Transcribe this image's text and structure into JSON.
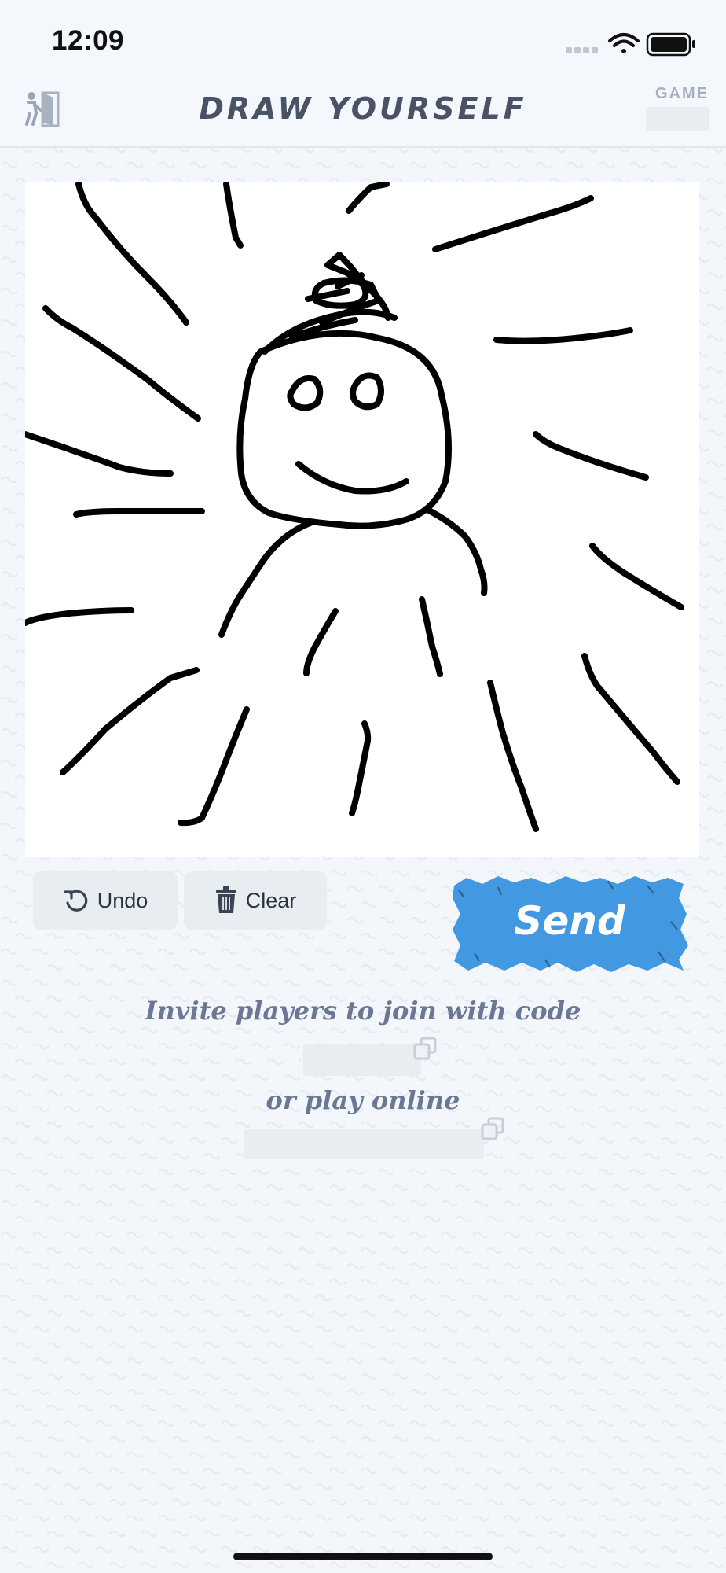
{
  "status_bar": {
    "time": "12:09"
  },
  "header": {
    "title": "DRAW YOURSELF",
    "game_label": "GAME"
  },
  "toolbar": {
    "undo_label": "Undo",
    "clear_label": "Clear",
    "send_label": "Send"
  },
  "invite": {
    "invite_text": "Invite players to join with code",
    "or_text": "or play online"
  },
  "colors": {
    "accent": "#4299e1",
    "text_muted": "#6b7894",
    "title": "#4a5266"
  },
  "icons": [
    "exit-icon",
    "undo-icon",
    "trash-icon",
    "copy-icon",
    "wifi-icon",
    "battery-icon",
    "signal-icon"
  ]
}
